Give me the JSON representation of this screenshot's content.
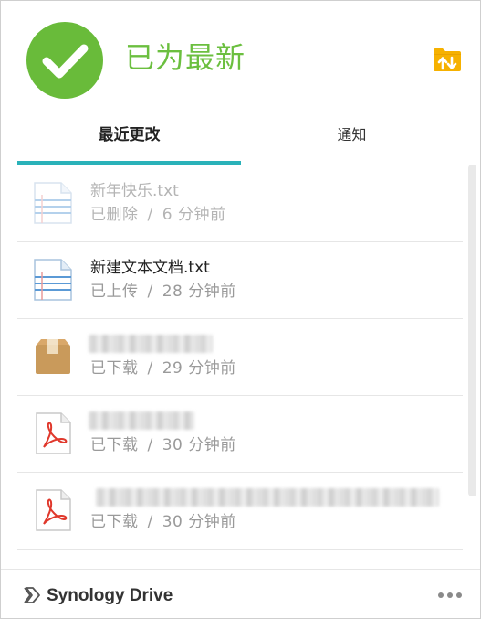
{
  "header": {
    "status_text": "已为最新",
    "status_icon": "check-circle-icon",
    "status_color": "#69bb3a",
    "action_icon": "folder-sync-icon",
    "action_color": "#f6b100"
  },
  "tabs": [
    {
      "label": "最近更改",
      "active": true
    },
    {
      "label": "通知",
      "active": false
    }
  ],
  "accent_color": "#2ab2b9",
  "items": [
    {
      "name": "新年快乐.txt",
      "status": "已删除",
      "separator": "/",
      "time": "6 分钟前",
      "icon": "text-file-icon",
      "state": "deleted"
    },
    {
      "name": "新建文本文档.txt",
      "status": "已上传",
      "separator": "/",
      "time": "28 分钟前",
      "icon": "text-file-icon",
      "state": "normal"
    },
    {
      "name": "",
      "status": "已下载",
      "separator": "/",
      "time": "29 分钟前",
      "icon": "archive-box-icon",
      "state": "blurred"
    },
    {
      "name": "",
      "status": "已下载",
      "separator": "/",
      "time": "30 分钟前",
      "icon": "pdf-file-icon",
      "state": "blurred"
    },
    {
      "name": "",
      "status": "已下载",
      "separator": "/",
      "time": "30 分钟前",
      "icon": "pdf-file-icon",
      "state": "blurred"
    }
  ],
  "footer": {
    "app_name": "Synology Drive",
    "logo_icon": "synology-drive-logo-icon",
    "more_icon": "more-dots-icon"
  }
}
